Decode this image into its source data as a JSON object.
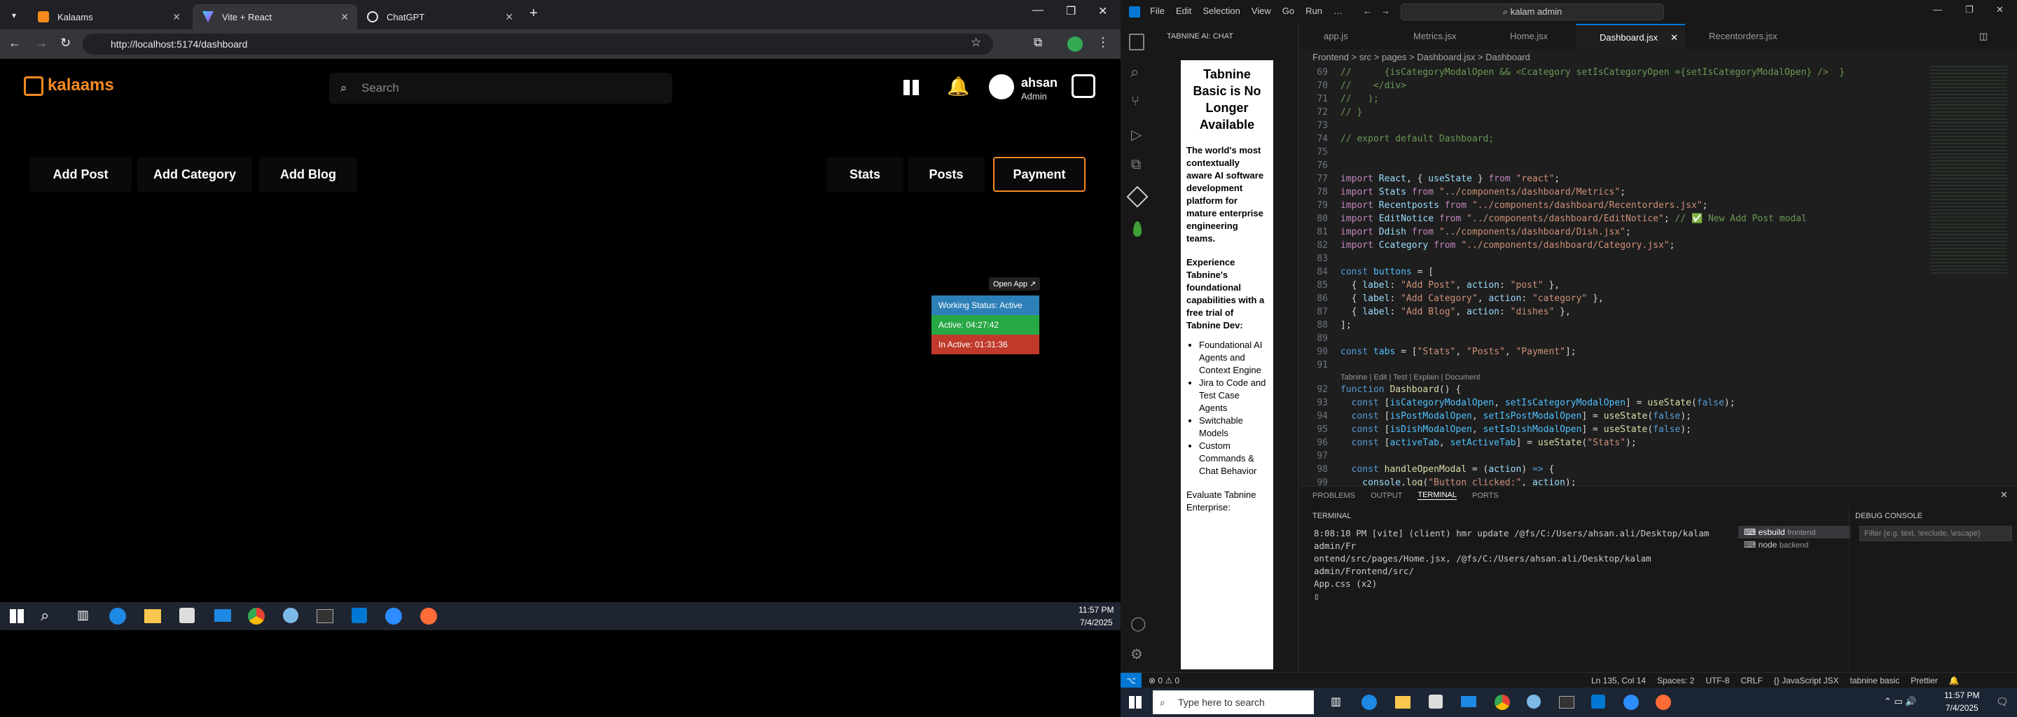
{
  "browser": {
    "tabs": [
      {
        "label": "Kalaams"
      },
      {
        "label": "Vite + React"
      },
      {
        "label": "ChatGPT"
      }
    ],
    "url": "http://localhost:5174/dashboard"
  },
  "app": {
    "logo": "kalaams",
    "search_placeholder": "Search",
    "user": {
      "name": "ahsan",
      "role": "Admin"
    },
    "actions": [
      "Add Post",
      "Add Category",
      "Add Blog"
    ],
    "tabs": [
      "Stats",
      "Posts",
      "Payment"
    ],
    "open_app": "Open App",
    "status": {
      "working": "Working Status: Active",
      "active": "Active: 04:27:42",
      "inactive": "In Active: 01:31:36"
    },
    "colors": {
      "accent": "#f58a1f",
      "working": "#2d7fb8",
      "active": "#28a745",
      "inactive": "#c0392b"
    }
  },
  "left_taskbar": {
    "time": "11:57 PM",
    "date": "7/4/2025"
  },
  "vscode": {
    "menu": [
      "File",
      "Edit",
      "Selection",
      "View",
      "Go",
      "Run",
      "…"
    ],
    "search": "kalam admin",
    "side_title": "TABNINE AI: CHAT",
    "side_heading": "Tabnine Basic is No Longer Available",
    "side_p1": "The world's most contextually aware AI software development platform for mature enterprise engineering teams.",
    "side_p2": "Experience Tabnine's foundational capabilities with a free trial of Tabnine Dev:",
    "side_list": [
      "Foundational AI Agents and Context Engine",
      "Jira to Code and Test Case Agents",
      "Switchable Models",
      "Custom Commands & Chat Behavior"
    ],
    "side_p3": "Evaluate Tabnine Enterprise:",
    "tabs": [
      "app.js",
      "Metrics.jsx",
      "Home.jsx",
      "Dashboard.jsx",
      "Recentorders.jsx"
    ],
    "breadcrumb": "Frontend > src > pages > Dashboard.jsx > Dashboard",
    "codelens": "Tabnine | Edit | Test | Explain | Document",
    "panel_tabs": [
      "PROBLEMS",
      "OUTPUT",
      "TERMINAL",
      "PORTS"
    ],
    "terminal_title": "TERMINAL",
    "terminal_text": [
      "8:08:10 PM [vite] (client) hmr update /@fs/C:/Users/ahsan.ali/Desktop/kalam admin/Fr",
      "ontend/src/pages/Home.jsx, /@fs/C:/Users/ahsan.ali/Desktop/kalam admin/Frontend/src/",
      "App.css (x2)"
    ],
    "terminals": [
      {
        "name": "esbuild",
        "dir": "frontend"
      },
      {
        "name": "node",
        "dir": "backend"
      }
    ],
    "debug_title": "DEBUG CONSOLE",
    "debug_placeholder": "Filter (e.g. text, !exclude, \\escape)",
    "status_left": "⊗ 0 ⚠ 0",
    "status_right": [
      "Ln 135, Col 14",
      "Spaces: 2",
      "UTF-8",
      "CRLF",
      "{} JavaScript JSX",
      "tabnine basic",
      "Prettier"
    ],
    "win_search": "Type here to search",
    "time": "11:57 PM",
    "date": "7/4/2025"
  }
}
